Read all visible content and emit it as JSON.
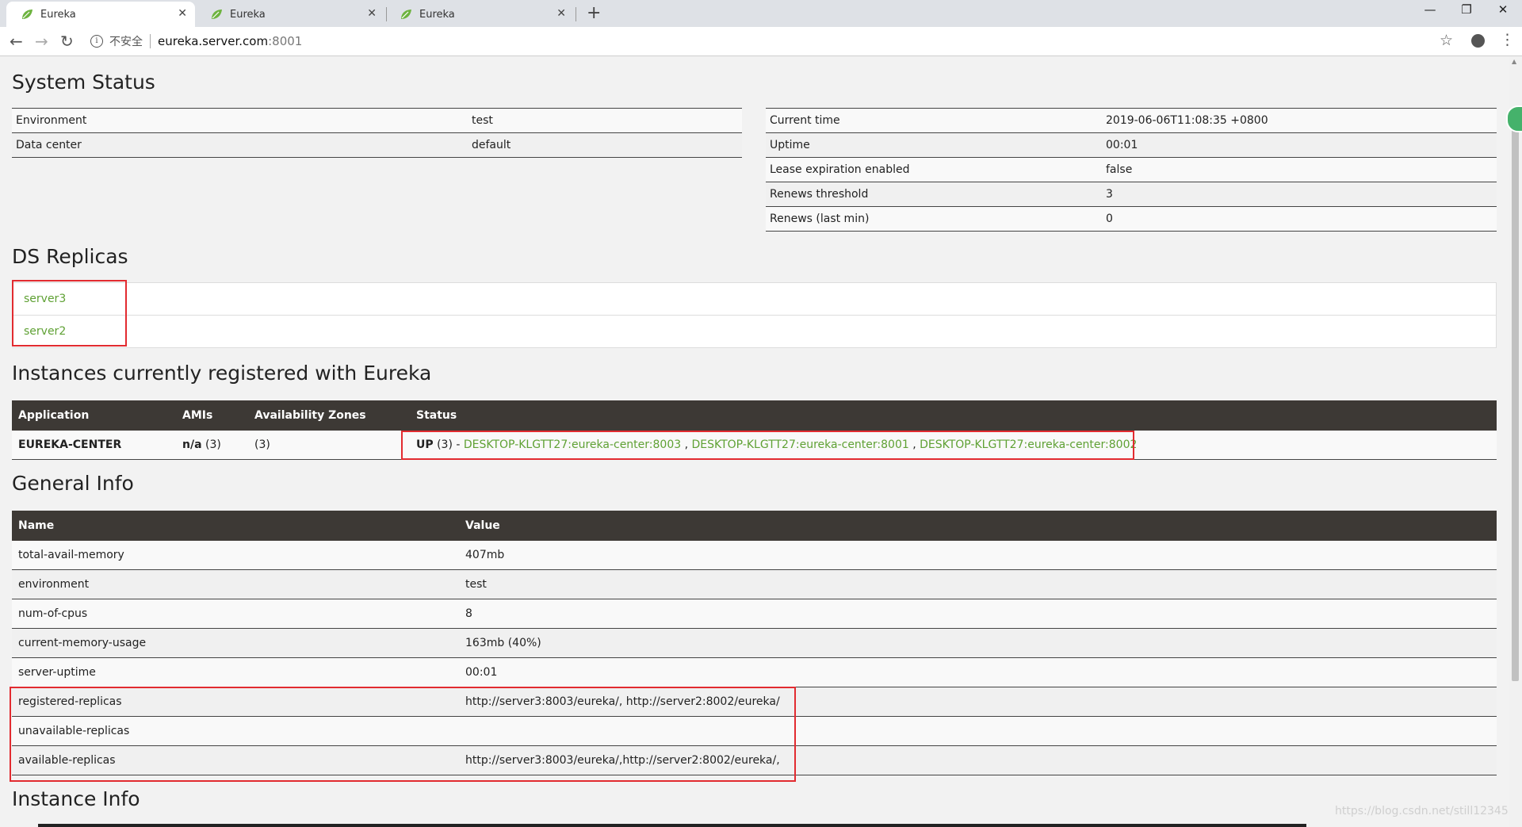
{
  "browser": {
    "tabs": [
      {
        "title": "Eureka"
      },
      {
        "title": "Eureka"
      },
      {
        "title": "Eureka"
      }
    ],
    "security_label": "不安全",
    "url_host": "eureka.server.com",
    "url_port": ":8001"
  },
  "system_status": {
    "title": "System Status",
    "left": [
      {
        "key": "Environment",
        "value": "test"
      },
      {
        "key": "Data center",
        "value": "default"
      }
    ],
    "right": [
      {
        "key": "Current time",
        "value": "2019-06-06T11:08:35 +0800"
      },
      {
        "key": "Uptime",
        "value": "00:01"
      },
      {
        "key": "Lease expiration enabled",
        "value": "false"
      },
      {
        "key": "Renews threshold",
        "value": "3"
      },
      {
        "key": "Renews (last min)",
        "value": "0"
      }
    ]
  },
  "ds_replicas": {
    "title": "DS Replicas",
    "items": [
      "server3",
      "server2"
    ]
  },
  "instances": {
    "title": "Instances currently registered with Eureka",
    "headers": [
      "Application",
      "AMIs",
      "Availability Zones",
      "Status"
    ],
    "rows": [
      {
        "application": "EUREKA-CENTER",
        "amis_bold": "n/a",
        "amis_count": " (3)",
        "zones": "(3)",
        "status_prefix": "UP",
        "status_count": " (3) - ",
        "links": [
          "DESKTOP-KLGTT27:eureka-center:8003",
          "DESKTOP-KLGTT27:eureka-center:8001",
          "DESKTOP-KLGTT27:eureka-center:8002"
        ],
        "link_sep": " , "
      }
    ]
  },
  "general_info": {
    "title": "General Info",
    "headers": [
      "Name",
      "Value"
    ],
    "rows": [
      {
        "name": "total-avail-memory",
        "value": "407mb"
      },
      {
        "name": "environment",
        "value": "test"
      },
      {
        "name": "num-of-cpus",
        "value": "8"
      },
      {
        "name": "current-memory-usage",
        "value": "163mb (40%)"
      },
      {
        "name": "server-uptime",
        "value": "00:01"
      },
      {
        "name": "registered-replicas",
        "value": "http://server3:8003/eureka/, http://server2:8002/eureka/"
      },
      {
        "name": "unavailable-replicas",
        "value": ""
      },
      {
        "name": "available-replicas",
        "value": "http://server3:8003/eureka/,http://server2:8002/eureka/,"
      }
    ]
  },
  "instance_info": {
    "title": "Instance Info"
  },
  "watermark": "https://blog.csdn.net/still123456",
  "colors": {
    "link_green": "#5fa134",
    "header_dark": "#3d3935",
    "highlight_red": "#e22b30"
  }
}
